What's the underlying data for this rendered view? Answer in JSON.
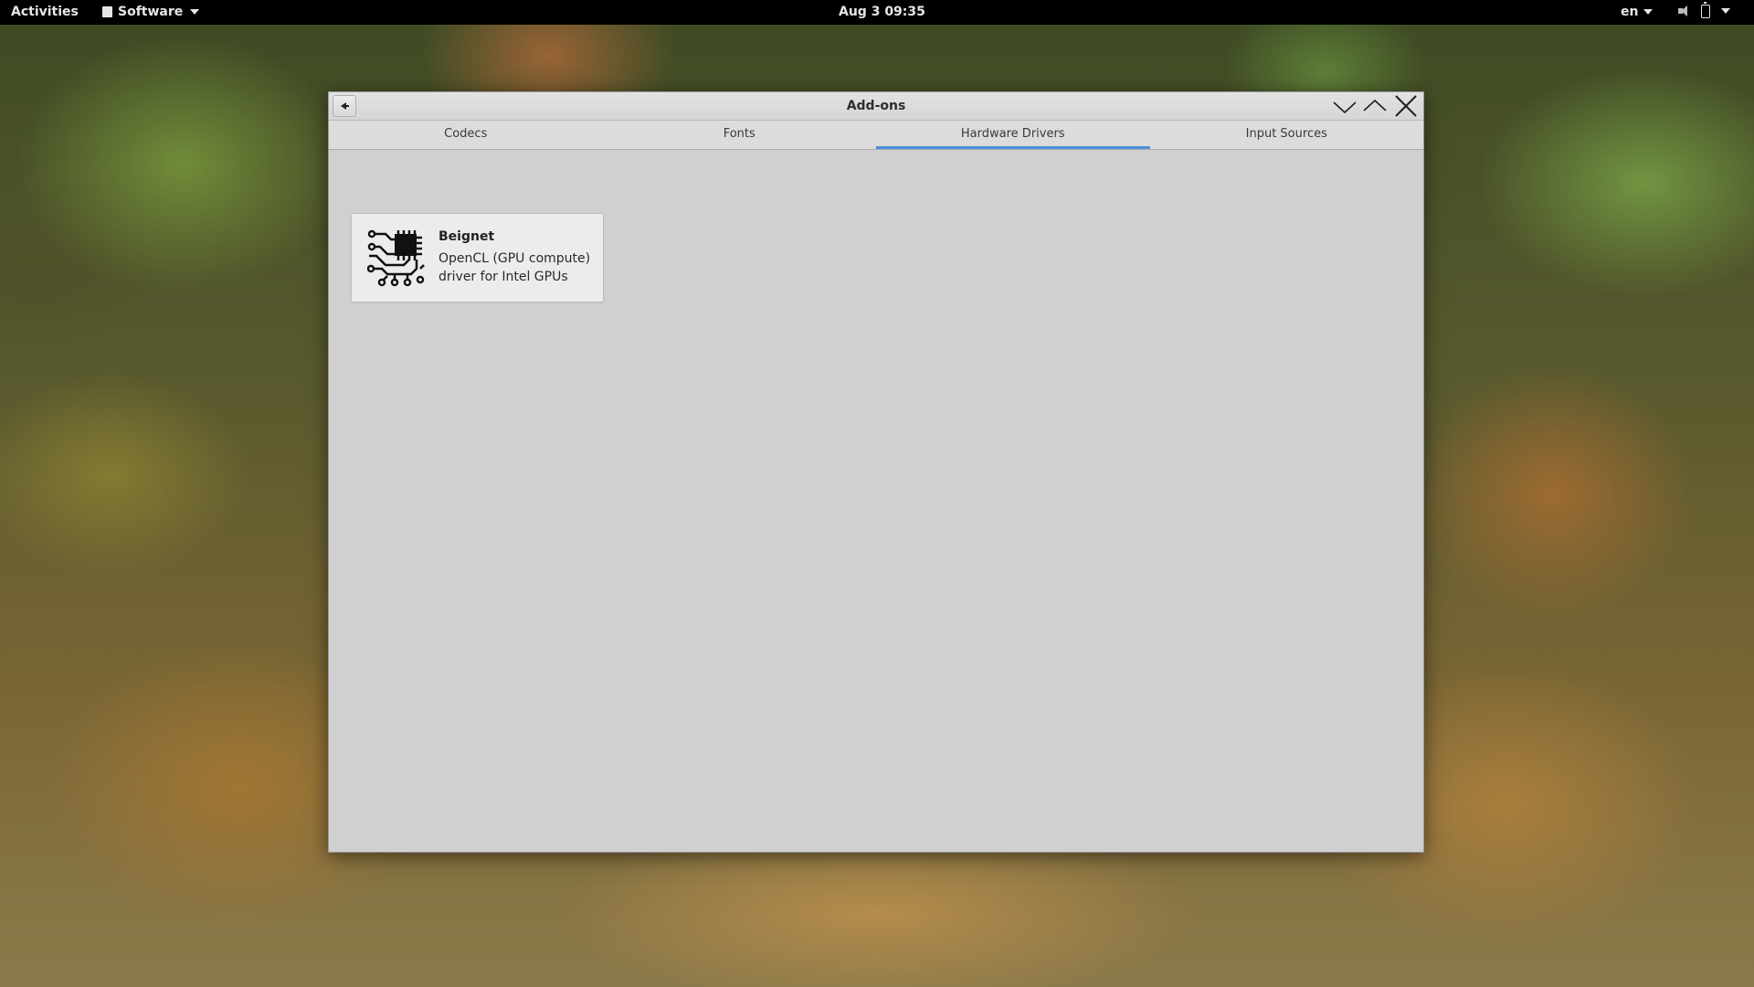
{
  "topbar": {
    "activities": "Activities",
    "app_menu": "Software",
    "clock": "Aug 3  09:35",
    "language": "en"
  },
  "window": {
    "title": "Add-ons",
    "tabs": [
      {
        "label": "Codecs",
        "active": false
      },
      {
        "label": "Fonts",
        "active": false
      },
      {
        "label": "Hardware Drivers",
        "active": true
      },
      {
        "label": "Input Sources",
        "active": false
      }
    ],
    "items": [
      {
        "name": "Beignet",
        "description": "OpenCL (GPU compute) driver for Intel GPUs",
        "icon": "chip-icon"
      }
    ]
  },
  "colors": {
    "accent": "#4a90d9",
    "window_bg": "#d0d0d0",
    "topbar_bg": "#000000"
  }
}
